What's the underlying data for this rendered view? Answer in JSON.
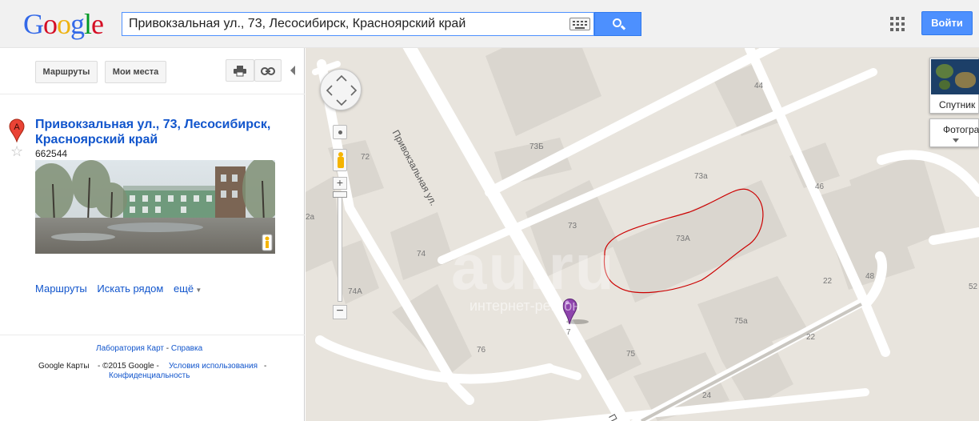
{
  "header": {
    "logo_letters": [
      {
        "ch": "G",
        "color": "#3369e8"
      },
      {
        "ch": "o",
        "color": "#d50f25"
      },
      {
        "ch": "o",
        "color": "#eeb211"
      },
      {
        "ch": "g",
        "color": "#3369e8"
      },
      {
        "ch": "l",
        "color": "#009925"
      },
      {
        "ch": "e",
        "color": "#d50f25"
      }
    ],
    "search_value": "Привокзальная ул., 73, Лесосибирск, Красноярский край",
    "signin_label": "Войти",
    "search_icon": "search-icon",
    "keyboard_icon": "keyboard-icon",
    "apps_icon": "apps-grid-icon"
  },
  "panel": {
    "routes_btn": "Маршруты",
    "myplaces_btn": "Мои места",
    "print_icon": "print-icon",
    "link_icon": "link-icon",
    "marker_letter": "A",
    "result": {
      "title": "Привокзальная ул., 73, Лесосибирск, Красноярский край",
      "postcode": "662544"
    },
    "actions": {
      "routes": "Маршруты",
      "nearby": "Искать рядом",
      "more": "ещё"
    },
    "footer": {
      "labs": "Лаборатория Карт",
      "dash": "-",
      "help": "Справка",
      "brand": "Google Карты",
      "copyright": "- ©2015 Google -",
      "terms": "Условия использования",
      "terms_sep": "-",
      "privacy": "Конфиденциальность"
    }
  },
  "map": {
    "street_label": "Привокзальная ул.",
    "street_label_partial": "П",
    "house_numbers": [
      "44",
      "72",
      "73Б",
      "73а",
      "46",
      "2а",
      "73",
      "73А",
      "74",
      "22",
      "48",
      "52",
      "74А",
      "75а",
      "7",
      "22",
      "76",
      "75",
      "24"
    ],
    "watermark": "au.ru",
    "watermark_sub": "интернет-регион",
    "satellite_label": "Спутник",
    "photos_label": "Фотогра",
    "colors": {
      "map_bg": "#e8e4dd",
      "road": "#ffffff",
      "building": "#dad6cf",
      "marker": "#8e44ad",
      "circle": "#cc0000"
    }
  }
}
